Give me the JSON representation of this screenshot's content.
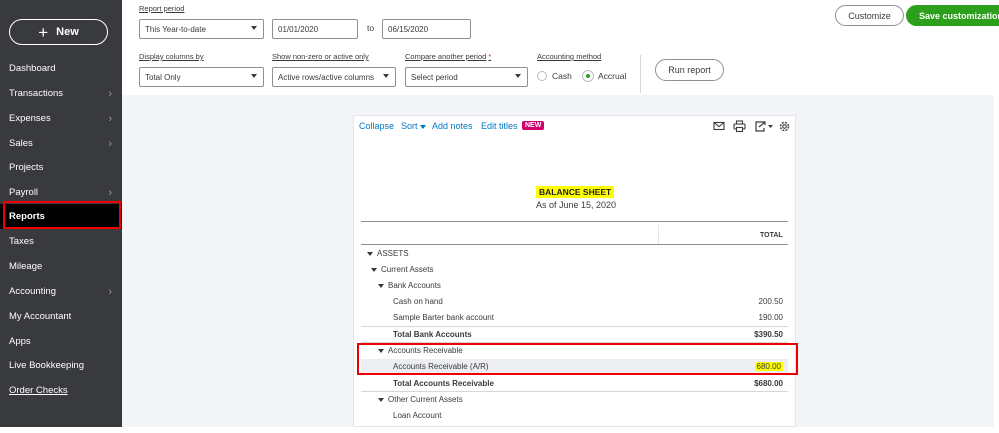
{
  "sidebar": {
    "new_label": "New",
    "items": [
      {
        "label": "Dashboard",
        "chevron": false
      },
      {
        "label": "Transactions",
        "chevron": true
      },
      {
        "label": "Expenses",
        "chevron": true
      },
      {
        "label": "Sales",
        "chevron": true
      },
      {
        "label": "Projects",
        "chevron": false
      },
      {
        "label": "Payroll",
        "chevron": true
      },
      {
        "label": "Reports",
        "chevron": false,
        "active": true
      },
      {
        "label": "Taxes",
        "chevron": false
      },
      {
        "label": "Mileage",
        "chevron": false
      },
      {
        "label": "Accounting",
        "chevron": true
      },
      {
        "label": "My Accountant",
        "chevron": false
      },
      {
        "label": "Apps",
        "chevron": false
      },
      {
        "label": "Live Bookkeeping",
        "chevron": false
      },
      {
        "label": "Order Checks",
        "chevron": false
      }
    ]
  },
  "controls": {
    "report_period_label": "Report period",
    "report_period_value": "This Year-to-date",
    "date_from": "01/01/2020",
    "to_label": "to",
    "date_to": "06/15/2020",
    "display_columns_label": "Display columns by",
    "display_columns_value": "Total Only",
    "show_nonzero_label": "Show non-zero or active only",
    "show_nonzero_value": "Active rows/active columns",
    "compare_label": "Compare another period",
    "compare_required": "*",
    "compare_value": "Select period",
    "accounting_method_label": "Accounting method",
    "cash_label": "Cash",
    "accrual_label": "Accrual",
    "selected_method": "Accrual",
    "run_report": "Run report",
    "customize": "Customize",
    "save_customization": "Save customization"
  },
  "toolbar": {
    "collapse": "Collapse",
    "sort": "Sort",
    "add_notes": "Add notes",
    "edit_titles": "Edit titles",
    "new_badge": "NEW",
    "icons": [
      "mail-icon",
      "print-icon",
      "export-icon",
      "settings-icon"
    ]
  },
  "report": {
    "title": "BALANCE SHEET",
    "subtitle": "As of June 15, 2020",
    "column_header": "TOTAL",
    "rows": {
      "assets": "ASSETS",
      "current_assets": "Current Assets",
      "bank_accounts": "Bank Accounts",
      "cash_on_hand": {
        "label": "Cash on hand",
        "value": "200.50"
      },
      "sample_barter": {
        "label": "Sample Barter bank account",
        "value": "190.00"
      },
      "total_bank": {
        "label": "Total Bank Accounts",
        "value": "$390.50"
      },
      "ar_group": "Accounts Receivable",
      "ar_account": {
        "label": "Accounts Receivable (A/R)",
        "value": "680.00"
      },
      "total_ar": {
        "label": "Total Accounts Receivable",
        "value": "$680.00"
      },
      "other_current": "Other Current Assets",
      "loan_account": "Loan Account"
    }
  },
  "colors": {
    "sidebar_bg": "#393a3d",
    "accent_green": "#2ca01c",
    "link_blue": "#0077c5",
    "highlight_yellow": "#ffff00",
    "annotation_red": "#ee0000",
    "badge_magenta": "#d0006f"
  }
}
